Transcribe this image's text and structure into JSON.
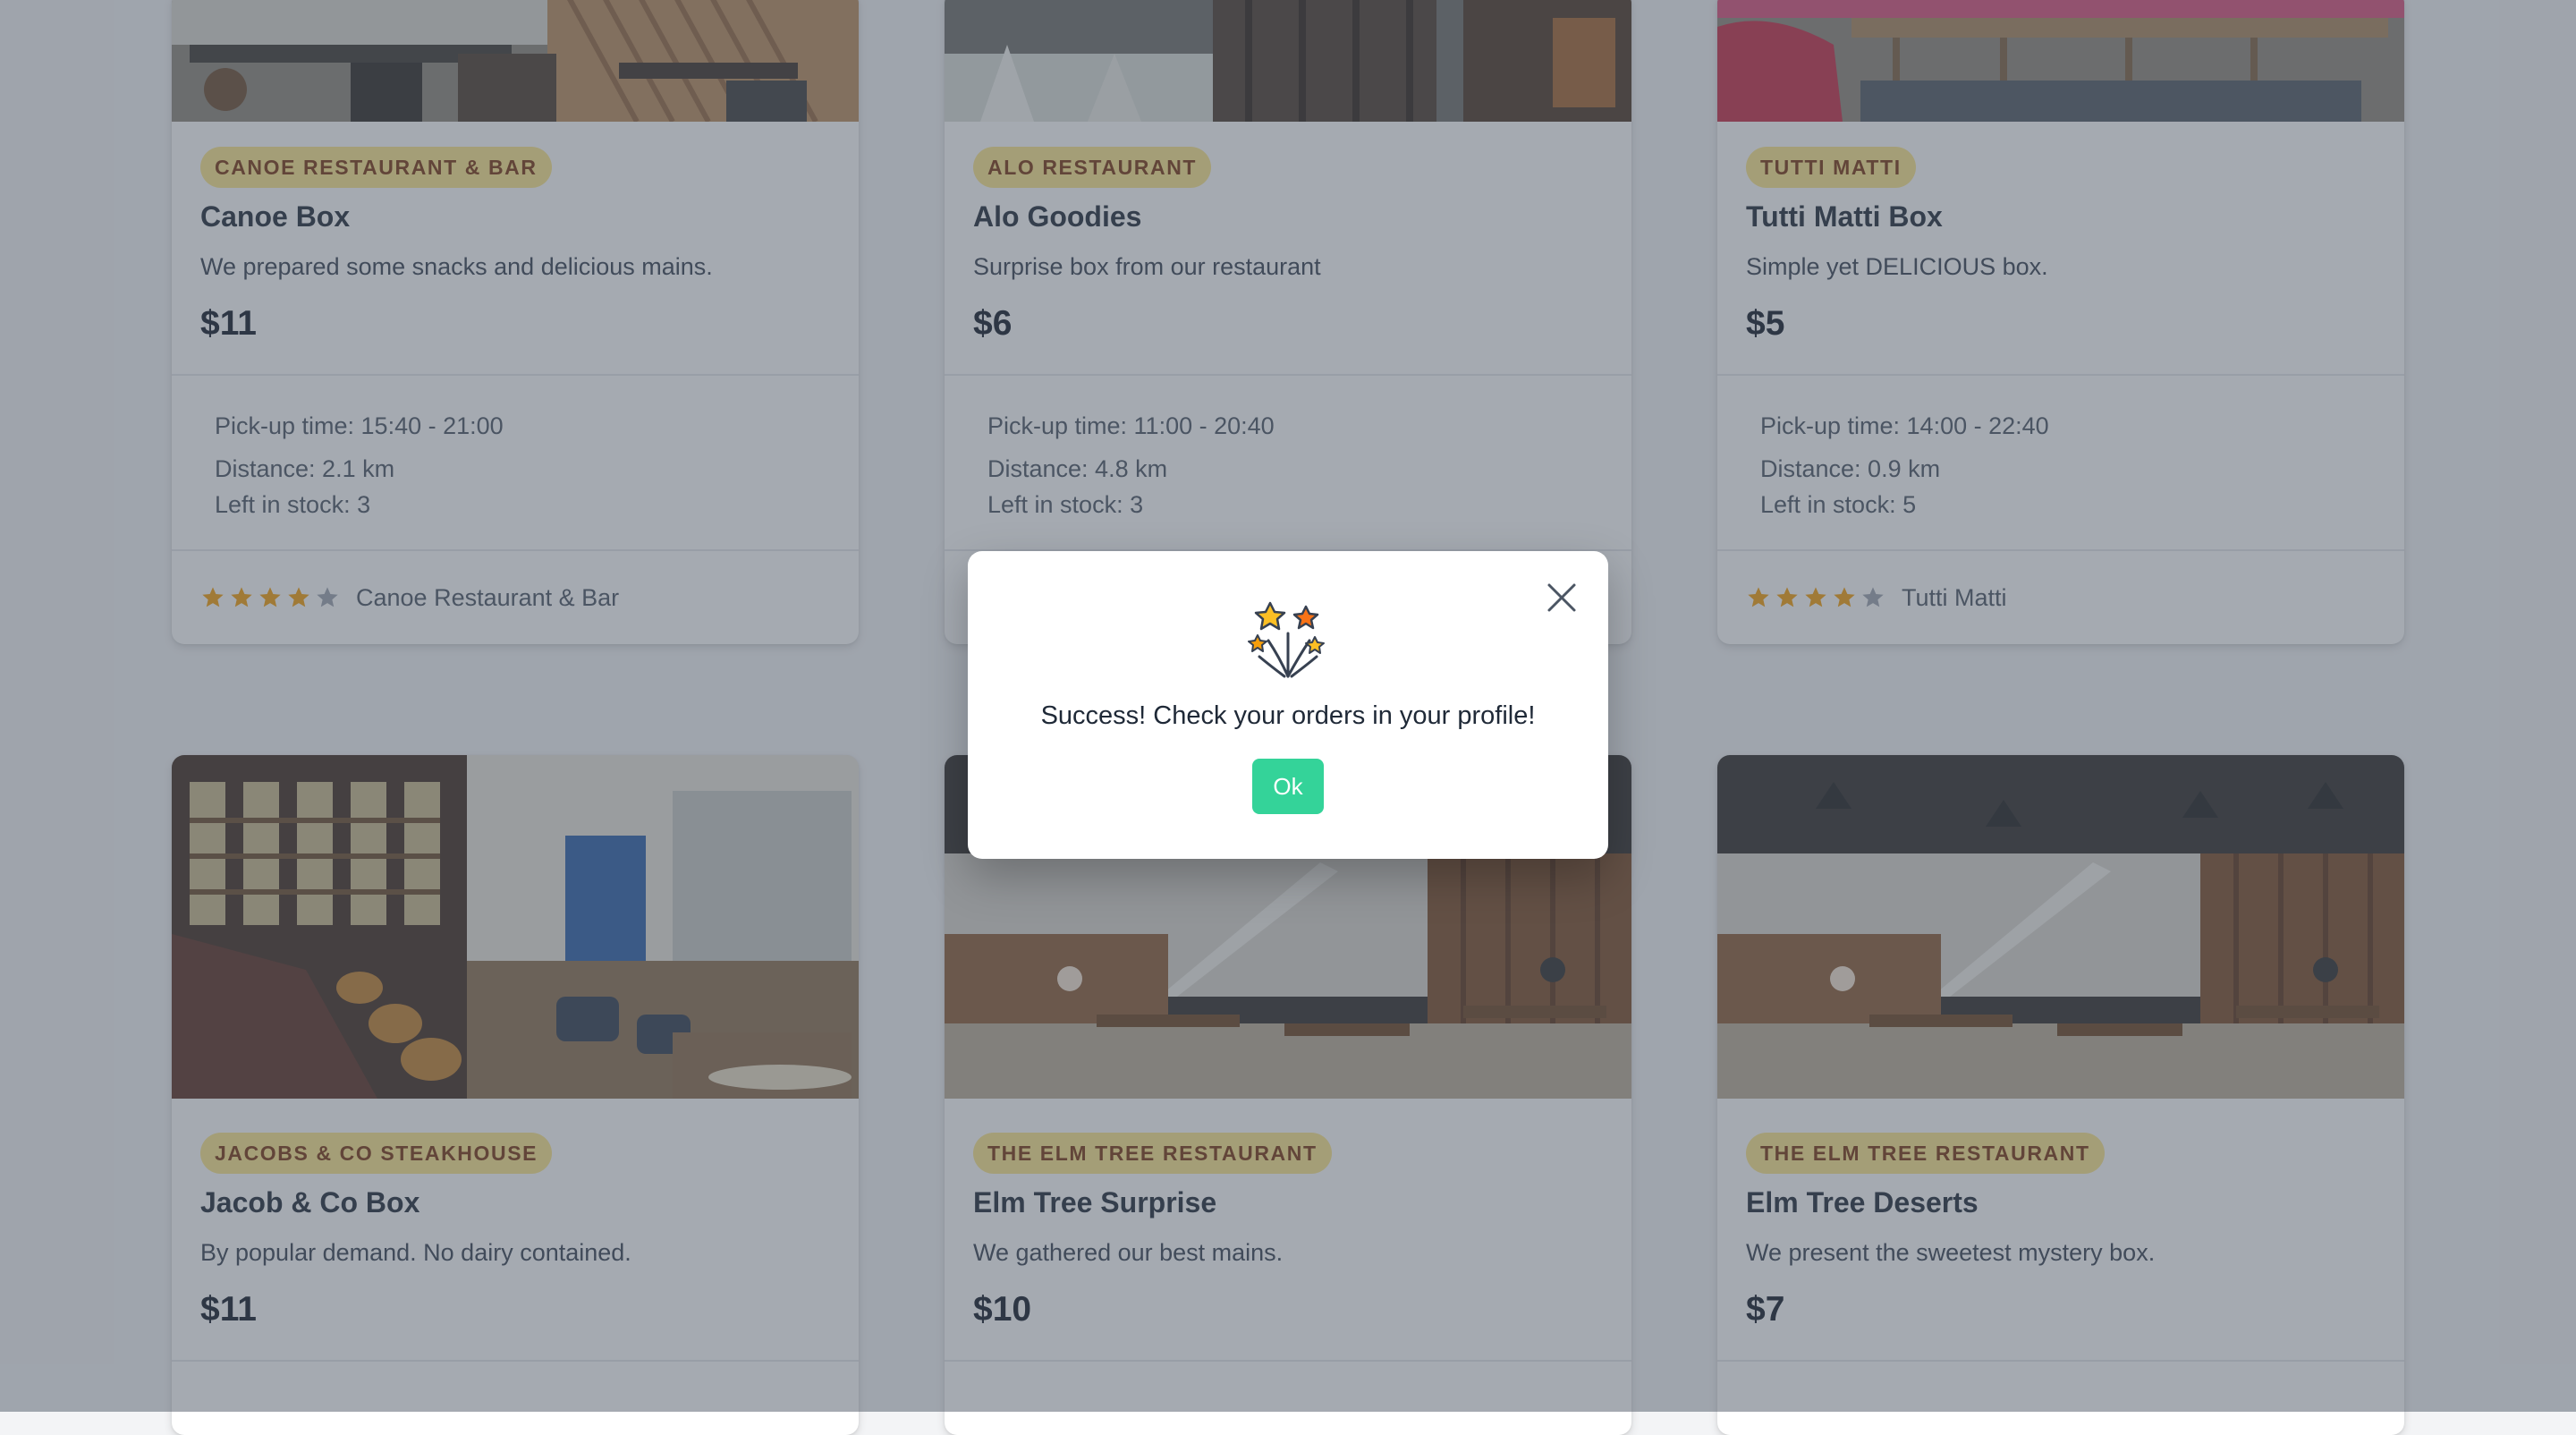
{
  "cards": [
    {
      "badge": "Canoe Restaurant & Bar",
      "title": "Canoe Box",
      "desc": "We prepared some snacks and delicious mains.",
      "price": "$11",
      "pickup": "Pick-up time: 15:40 - 21:00",
      "distance": "Distance: 2.1 km",
      "stock": "Left in stock: 3",
      "footer_name": "Canoe Restaurant & Bar",
      "rating": 4
    },
    {
      "badge": "Alo Restaurant",
      "title": "Alo Goodies",
      "desc": "Surprise box from our restaurant",
      "price": "$6",
      "pickup": "Pick-up time: 11:00 - 20:40",
      "distance": "Distance: 4.8 km",
      "stock": "Left in stock: 3"
    },
    {
      "badge": "Tutti Matti",
      "title": "Tutti Matti Box",
      "desc": "Simple yet DELICIOUS box.",
      "price": "$5",
      "pickup": "Pick-up time: 14:00 - 22:40",
      "distance": "Distance: 0.9 km",
      "stock": "Left in stock: 5",
      "footer_name": "Tutti Matti",
      "rating": 4
    },
    {
      "badge": "Jacobs & Co Steakhouse",
      "title": "Jacob & Co Box",
      "desc": "By popular demand. No dairy contained.",
      "price": "$11"
    },
    {
      "badge": "The Elm Tree Restaurant",
      "title": "Elm Tree Surprise",
      "desc": "We gathered our best mains.",
      "price": "$10"
    },
    {
      "badge": "The Elm Tree Restaurant",
      "title": "Elm Tree Deserts",
      "desc": "We present the sweetest mystery box.",
      "price": "$7"
    }
  ],
  "modal": {
    "icon": "fireworks-icon",
    "message": "Success! Check your orders in your profile!",
    "ok_label": "Ok"
  },
  "colors": {
    "badge_bg": "#fde68a",
    "badge_text": "#78350f",
    "star_filled": "#f59e0b",
    "star_empty": "#9ca3af",
    "ok_button": "#34d399",
    "overlay": "#4b5563"
  }
}
